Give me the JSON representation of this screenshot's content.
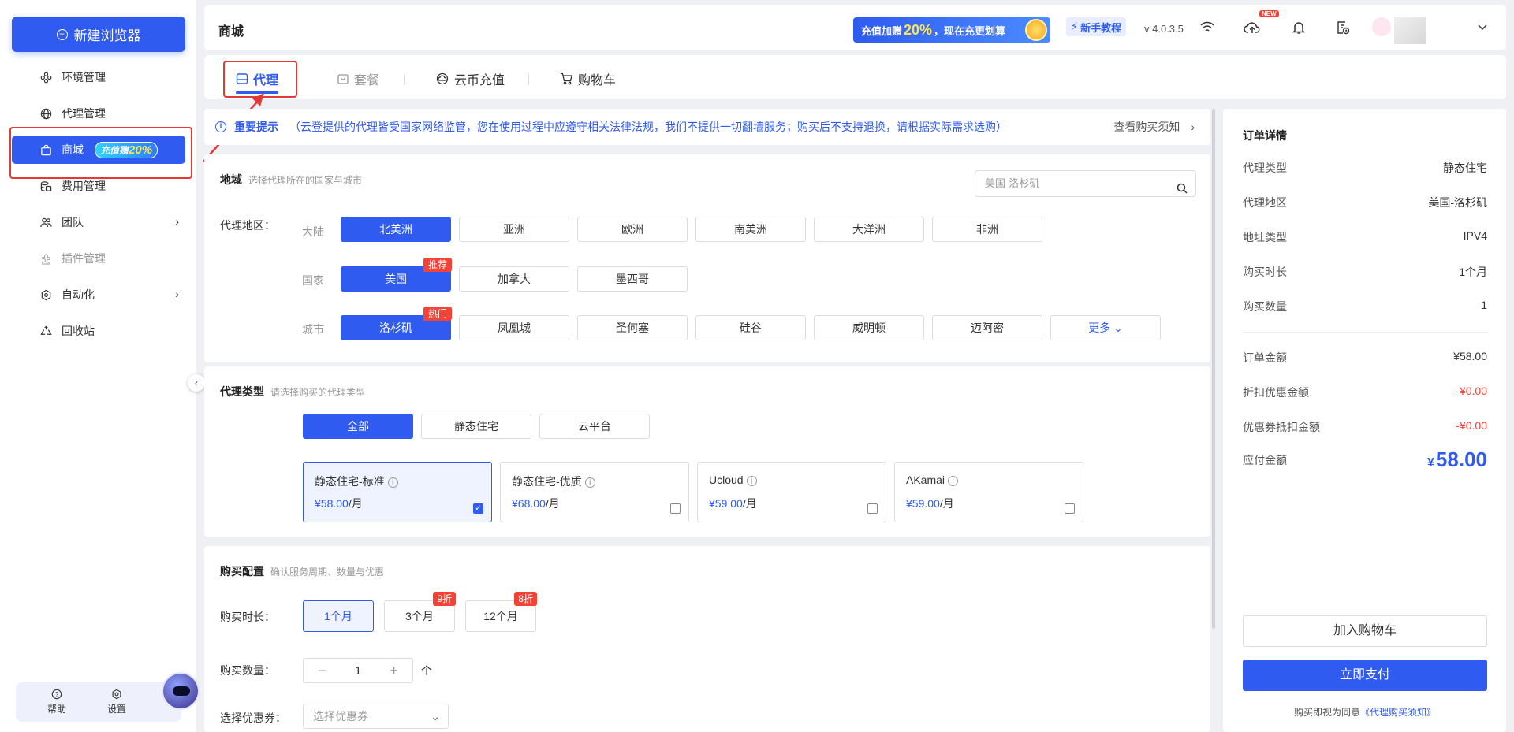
{
  "sidebar": {
    "new_button": "新建浏览器",
    "items": [
      {
        "label": "环境管理",
        "icon": "environment-icon"
      },
      {
        "label": "代理管理",
        "icon": "globe-icon"
      },
      {
        "label": "商城",
        "icon": "shopping-bag-icon",
        "badge_text": "充值赠",
        "badge_value": "20%"
      },
      {
        "label": "费用管理",
        "icon": "coins-icon"
      },
      {
        "label": "团队",
        "icon": "team-icon"
      },
      {
        "label": "插件管理",
        "icon": "plugin-icon"
      },
      {
        "label": "自动化",
        "icon": "automation-icon"
      },
      {
        "label": "回收站",
        "icon": "recycle-icon"
      }
    ],
    "help": "帮助",
    "settings": "设置"
  },
  "header": {
    "title": "商城",
    "promo_prefix": "充值加赠",
    "promo_value": "20%",
    "promo_suffix": "，现在充更划算",
    "tutorial": "新手教程",
    "version": "v 4.0.3.5",
    "new_tag": "NEW"
  },
  "tabs": [
    {
      "label": "代理"
    },
    {
      "label": "套餐"
    },
    {
      "label": "云币充值"
    },
    {
      "label": "购物车"
    }
  ],
  "notice": {
    "title": "重要提示",
    "text": "（云登提供的代理皆受国家网络监管，您在使用过程中应遵守相关法律法规，我们不提供一切翻墙服务；购买后不支持退换，请根据实际需求选购）",
    "link": "查看购买须知"
  },
  "region": {
    "title": "地域",
    "subtitle": "选择代理所在的国家与城市",
    "search_placeholder": "美国-洛杉矶",
    "row_label": "代理地区：",
    "continent_label": "大陆",
    "continents": [
      "北美洲",
      "亚洲",
      "欧洲",
      "南美洲",
      "大洋洲",
      "非洲"
    ],
    "country_label": "国家",
    "countries": [
      "美国",
      "加拿大",
      "墨西哥"
    ],
    "country_tag": "推荐",
    "city_label": "城市",
    "cities": [
      "洛杉矶",
      "凤凰城",
      "圣何塞",
      "硅谷",
      "威明顿",
      "迈阿密"
    ],
    "city_tag": "热门",
    "more": "更多"
  },
  "proxy_type": {
    "title": "代理类型",
    "subtitle": "请选择购买的代理类型",
    "filters": [
      "全部",
      "静态住宅",
      "云平台"
    ],
    "products": [
      {
        "name": "静态住宅-标准",
        "price": "¥58.00",
        "unit": "/月",
        "selected": true
      },
      {
        "name": "静态住宅-优质",
        "price": "¥68.00",
        "unit": "/月",
        "selected": false
      },
      {
        "name": "Ucloud",
        "price": "¥59.00",
        "unit": "/月",
        "selected": false
      },
      {
        "name": "AKamai",
        "price": "¥59.00",
        "unit": "/月",
        "selected": false
      }
    ]
  },
  "purchase": {
    "title": "购买配置",
    "subtitle": "确认服务周期、数量与优惠",
    "duration_label": "购买时长：",
    "durations": [
      {
        "label": "1个月",
        "tag": ""
      },
      {
        "label": "3个月",
        "tag": "9折"
      },
      {
        "label": "12个月",
        "tag": "8折"
      }
    ],
    "qty_label": "购买数量：",
    "qty_value": "1",
    "qty_unit": "个",
    "coupon_label": "选择优惠券：",
    "coupon_placeholder": "选择优惠券"
  },
  "order": {
    "title": "订单详情",
    "rows": [
      {
        "label": "代理类型",
        "value": "静态住宅"
      },
      {
        "label": "代理地区",
        "value": "美国-洛杉矶"
      },
      {
        "label": "地址类型",
        "value": "IPV4"
      },
      {
        "label": "购买时长",
        "value": "1个月"
      },
      {
        "label": "购买数量",
        "value": "1"
      }
    ],
    "amount_label": "订单金额",
    "amount": "¥58.00",
    "discount_label": "折扣优惠金额",
    "discount": "-¥0.00",
    "coupon_label": "优惠券抵扣金额",
    "coupon": "-¥0.00",
    "payable_label": "应付金额",
    "payable_symbol": "¥",
    "payable": "58.00",
    "add_cart": "加入购物车",
    "pay_now": "立即支付",
    "agree_text": "购买即视为同意",
    "agree_link": "《代理购买须知》"
  },
  "colors": {
    "accent": "#2f5bf0",
    "danger": "#f44336",
    "annotation": "#e53935"
  }
}
